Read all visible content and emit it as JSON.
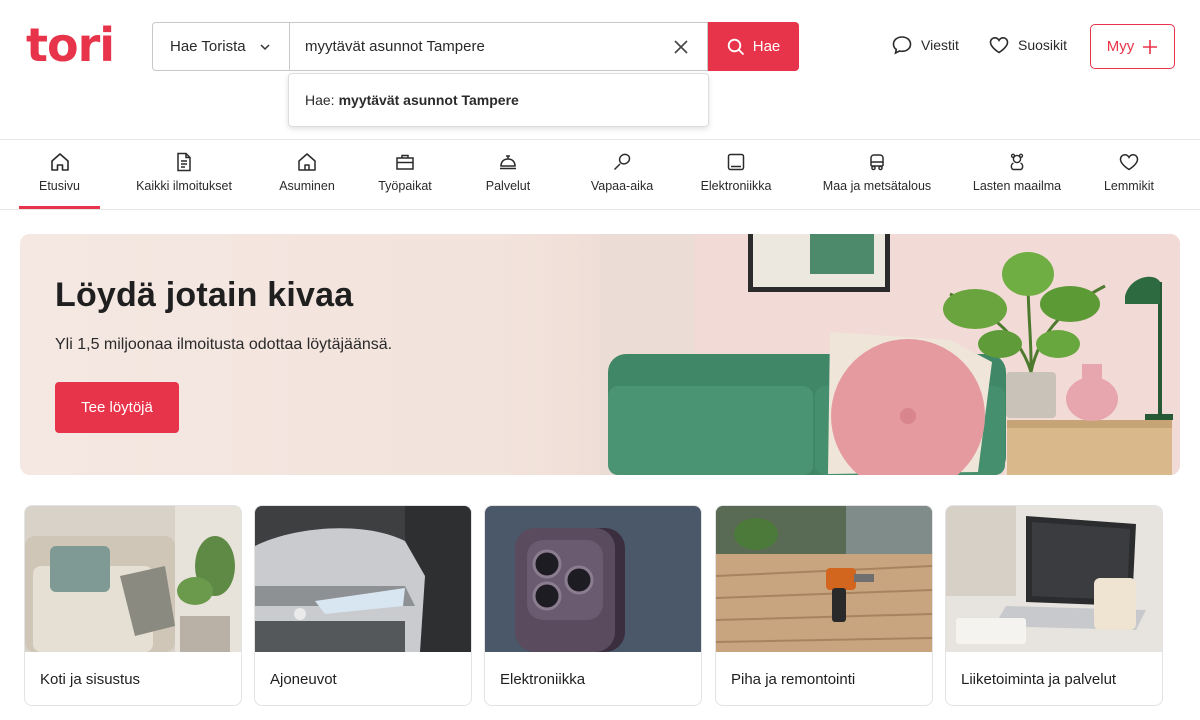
{
  "header": {
    "logo": "tori",
    "search_scope": "Hae Torista",
    "search_value": "myytävät asunnot Tampere",
    "search_button": "Hae",
    "suggestion_prefix": "Hae:",
    "suggestion_query": "myytävät asunnot Tampere",
    "messages_label": "Viestit",
    "favorites_label": "Suosikit",
    "sell_label": "Myy"
  },
  "nav": {
    "items": [
      {
        "label": "Etusivu",
        "icon": "home-icon",
        "active": true
      },
      {
        "label": "Kaikki ilmoitukset",
        "icon": "document-icon"
      },
      {
        "label": "Asuminen",
        "icon": "house-icon"
      },
      {
        "label": "Työpaikat",
        "icon": "briefcase-icon"
      },
      {
        "label": "Palvelut",
        "icon": "service-bell-icon"
      },
      {
        "label": "Vapaa-aika",
        "icon": "racket-icon"
      },
      {
        "label": "Elektroniikka",
        "icon": "tablet-icon"
      },
      {
        "label": "Maa ja metsätalous",
        "icon": "tractor-icon"
      },
      {
        "label": "Lasten maailma",
        "icon": "teddy-icon"
      },
      {
        "label": "Lemmikit",
        "icon": "heart-icon"
      }
    ]
  },
  "hero": {
    "title": "Löydä jotain kivaa",
    "subtitle": "Yli 1,5 miljoonaa ilmoitusta odottaa löytäjäänsä.",
    "button": "Tee löytöjä"
  },
  "categories": [
    {
      "label": "Koti ja sisustus"
    },
    {
      "label": "Ajoneuvot"
    },
    {
      "label": "Elektroniikka"
    },
    {
      "label": "Piha ja remontointi"
    },
    {
      "label": "Liiketoiminta ja palvelut"
    }
  ],
  "colors": {
    "brand": "#e8344a",
    "hero_bg": "#f3e6e0"
  }
}
